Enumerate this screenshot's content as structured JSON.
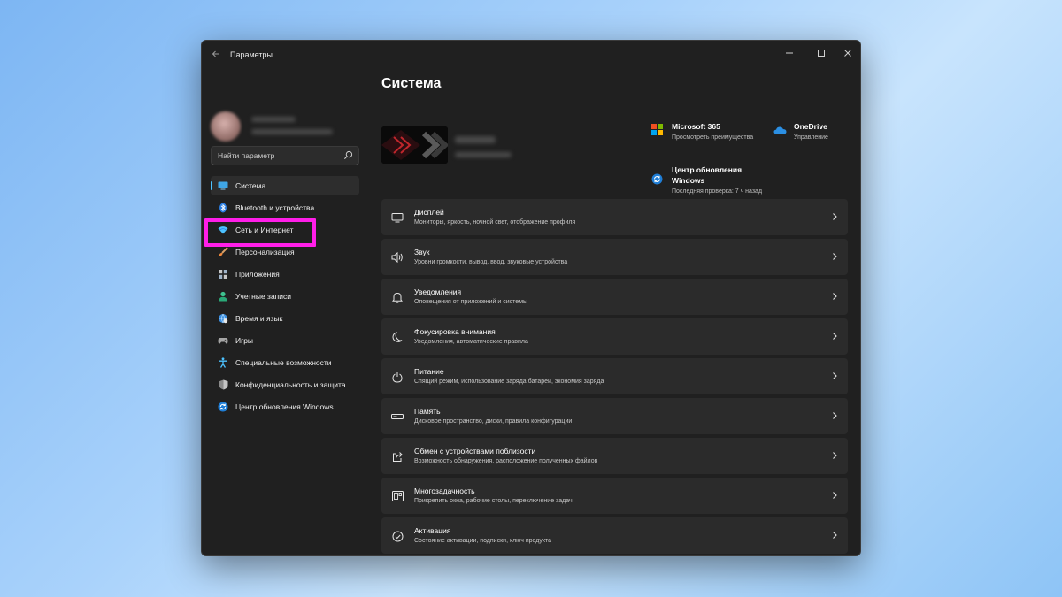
{
  "window": {
    "title": "Параметры"
  },
  "search": {
    "placeholder": "Найти параметр"
  },
  "sidebar": {
    "items": [
      {
        "label": "Система",
        "icon": "monitor-icon"
      },
      {
        "label": "Bluetooth и устройства",
        "icon": "bluetooth-icon"
      },
      {
        "label": "Сеть и Интернет",
        "icon": "wifi-icon"
      },
      {
        "label": "Персонализация",
        "icon": "brush-icon"
      },
      {
        "label": "Приложения",
        "icon": "apps-icon"
      },
      {
        "label": "Учетные записи",
        "icon": "person-icon"
      },
      {
        "label": "Время и язык",
        "icon": "globe-clock-icon"
      },
      {
        "label": "Игры",
        "icon": "gamepad-icon"
      },
      {
        "label": "Специальные возможности",
        "icon": "accessibility-icon"
      },
      {
        "label": "Конфиденциальность и защита",
        "icon": "shield-icon"
      },
      {
        "label": "Центр обновления Windows",
        "icon": "update-icon"
      }
    ],
    "active_index": 0,
    "highlighted_index": 2
  },
  "main": {
    "title": "Система"
  },
  "promos": {
    "m365": {
      "title": "Microsoft 365",
      "subtitle": "Просмотреть преимущества"
    },
    "onedrive": {
      "title": "OneDrive",
      "subtitle": "Управление"
    },
    "update": {
      "title_line1": "Центр обновления",
      "title_line2": "Windows",
      "subtitle": "Последняя проверка: 7 ч назад"
    }
  },
  "cards": [
    {
      "title": "Дисплей",
      "subtitle": "Мониторы, яркость, ночной свет, отображение профиля",
      "icon": "display-icon"
    },
    {
      "title": "Звук",
      "subtitle": "Уровни громкости, вывод, ввод, звуковые устройства",
      "icon": "speaker-icon"
    },
    {
      "title": "Уведомления",
      "subtitle": "Оповещения от приложений и системы",
      "icon": "bell-icon"
    },
    {
      "title": "Фокусировка внимания",
      "subtitle": "Уведомления, автоматические правила",
      "icon": "moon-icon"
    },
    {
      "title": "Питание",
      "subtitle": "Спящий режим, использование заряда батареи, экономия заряда",
      "icon": "power-icon"
    },
    {
      "title": "Память",
      "subtitle": "Дисковое пространство, диски, правила конфигурации",
      "icon": "storage-icon"
    },
    {
      "title": "Обмен с устройствами поблизости",
      "subtitle": "Возможность обнаружения, расположение полученных файлов",
      "icon": "share-icon"
    },
    {
      "title": "Многозадачность",
      "subtitle": "Прикрепить окна, рабочие столы, переключение задач",
      "icon": "multitask-icon"
    },
    {
      "title": "Активация",
      "subtitle": "Состояние активации, подписки, ключ продукта",
      "icon": "check-circle-icon"
    }
  ],
  "colors": {
    "accent": "#4cc2ff",
    "highlight_box": "#ff1ee8",
    "window_bg": "#202020",
    "card_bg": "#2b2b2b"
  }
}
